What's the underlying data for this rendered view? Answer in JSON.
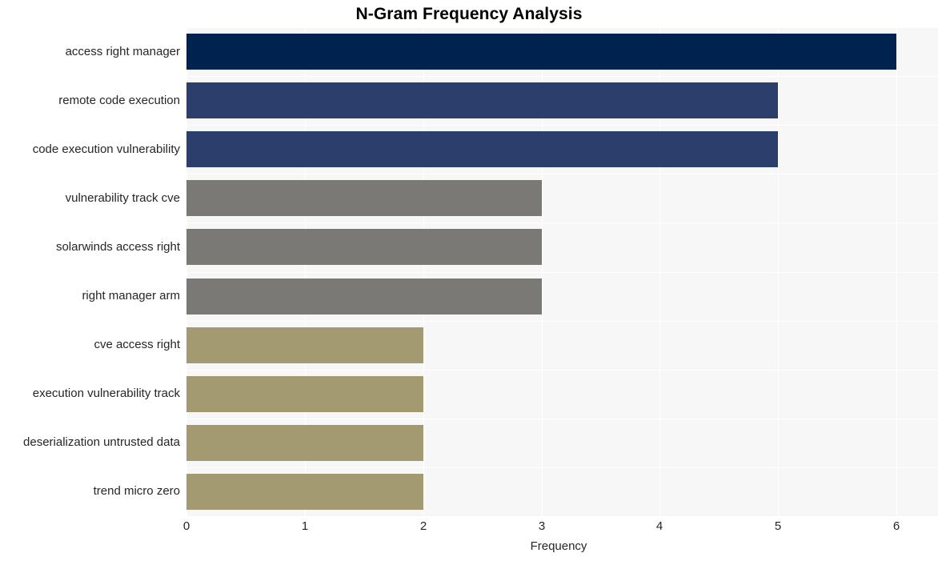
{
  "chart_data": {
    "type": "bar",
    "orientation": "horizontal",
    "title": "N-Gram Frequency Analysis",
    "xlabel": "Frequency",
    "ylabel": "",
    "xlim": [
      0,
      6.35
    ],
    "xticks": [
      0,
      1,
      2,
      3,
      4,
      5,
      6
    ],
    "xtick_labels": [
      "0",
      "1",
      "2",
      "3",
      "4",
      "5",
      "6"
    ],
    "grid": true,
    "grid_color": "#ffffff",
    "plot_background": "#f7f7f7",
    "figure_background": "#ffffff",
    "legend": null,
    "categories": [
      "access right manager",
      "remote code execution",
      "code execution vulnerability",
      "vulnerability track cve",
      "solarwinds access right",
      "right manager arm",
      "cve access right",
      "execution vulnerability track",
      "deserialization untrusted data",
      "trend micro zero"
    ],
    "values": [
      6,
      5,
      5,
      3,
      3,
      3,
      2,
      2,
      2,
      2
    ],
    "bar_colors": [
      "#00224e",
      "#2c3e6c",
      "#2c3e6c",
      "#7b7976",
      "#7b7976",
      "#7b7976",
      "#a39a72",
      "#a39a72",
      "#a39a72",
      "#a39a72"
    ]
  },
  "colors": {
    "navy_dark": "#00224e",
    "navy_mid": "#2c3e6c",
    "gray": "#7b7976",
    "tan": "#a39a72",
    "text": "#262626",
    "title": "#000000",
    "plot_bg": "#f7f7f7",
    "grid": "#ffffff"
  }
}
